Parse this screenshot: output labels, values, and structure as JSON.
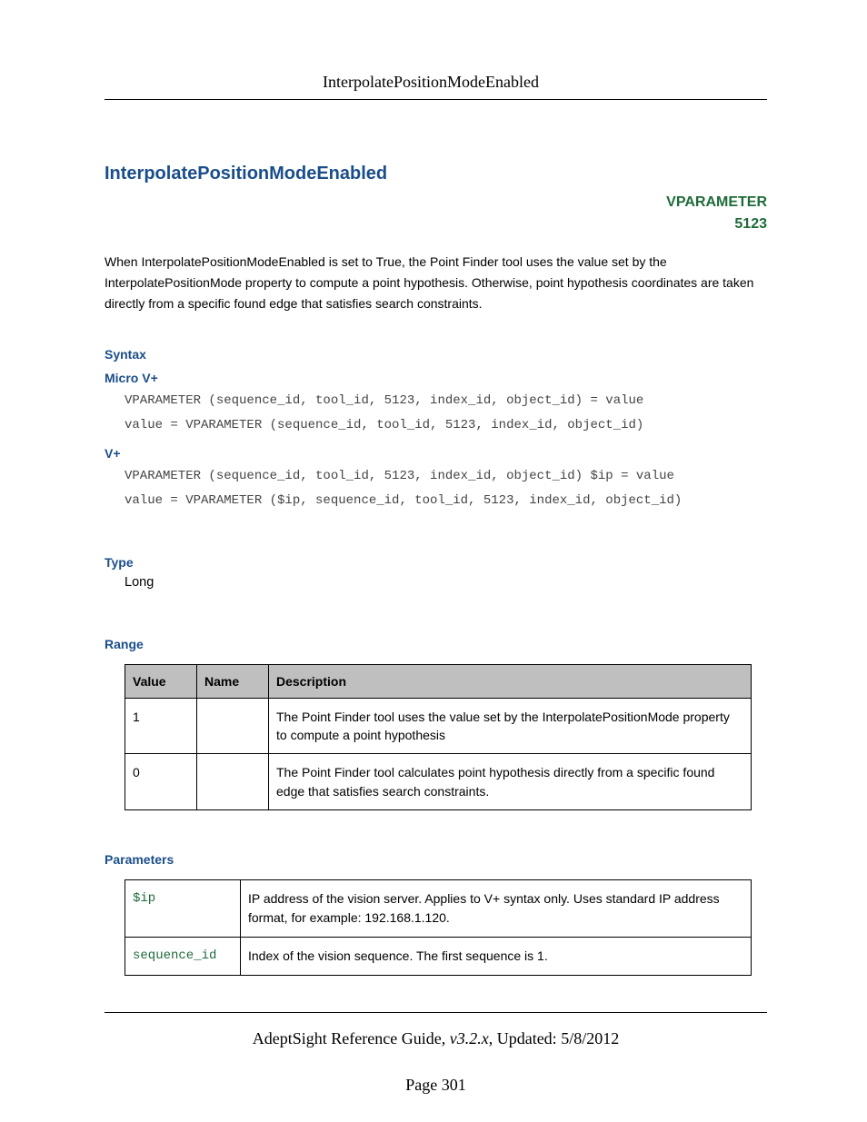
{
  "header": {
    "title": "InterpolatePositionModeEnabled"
  },
  "main": {
    "title": "InterpolatePositionModeEnabled",
    "vparam_label": "VPARAMETER",
    "vparam_number": "5123",
    "description": "When InterpolatePositionModeEnabled is set to True, the Point Finder tool uses the value set by the InterpolatePositionMode property to compute a point hypothesis. Otherwise, point hypothesis coordinates are taken directly from a specific found edge that satisfies search constraints."
  },
  "syntax": {
    "heading": "Syntax",
    "micro_label": "Micro V+",
    "micro_code": "VPARAMETER (sequence_id, tool_id, 5123, index_id, object_id) = value\nvalue = VPARAMETER (sequence_id, tool_id, 5123, index_id, object_id)",
    "vplus_label": "V+",
    "vplus_code": "VPARAMETER (sequence_id, tool_id, 5123, index_id, object_id) $ip = value\nvalue = VPARAMETER ($ip, sequence_id, tool_id, 5123, index_id, object_id)"
  },
  "type": {
    "heading": "Type",
    "value": "Long"
  },
  "range": {
    "heading": "Range",
    "headers": {
      "value": "Value",
      "name": "Name",
      "description": "Description"
    },
    "rows": [
      {
        "value": "1",
        "name": "",
        "description": "The Point Finder tool uses the value set by the InterpolatePositionMode property to compute a point hypothesis"
      },
      {
        "value": "0",
        "name": "",
        "description": "The Point Finder tool calculates point hypothesis directly from a specific found edge that satisfies search constraints."
      }
    ]
  },
  "parameters": {
    "heading": "Parameters",
    "rows": [
      {
        "param": "$ip",
        "description": "IP address of the vision server. Applies to V+ syntax only. Uses standard IP address format, for example: 192.168.1.120."
      },
      {
        "param": "sequence_id",
        "description": "Index of the vision sequence. The first sequence is 1."
      }
    ]
  },
  "footer": {
    "guide": "AdeptSight Reference Guide",
    "version": "v3.2.x",
    "updated_label": "Updated: ",
    "updated_date": "5/8/2012",
    "page": "Page 301"
  }
}
